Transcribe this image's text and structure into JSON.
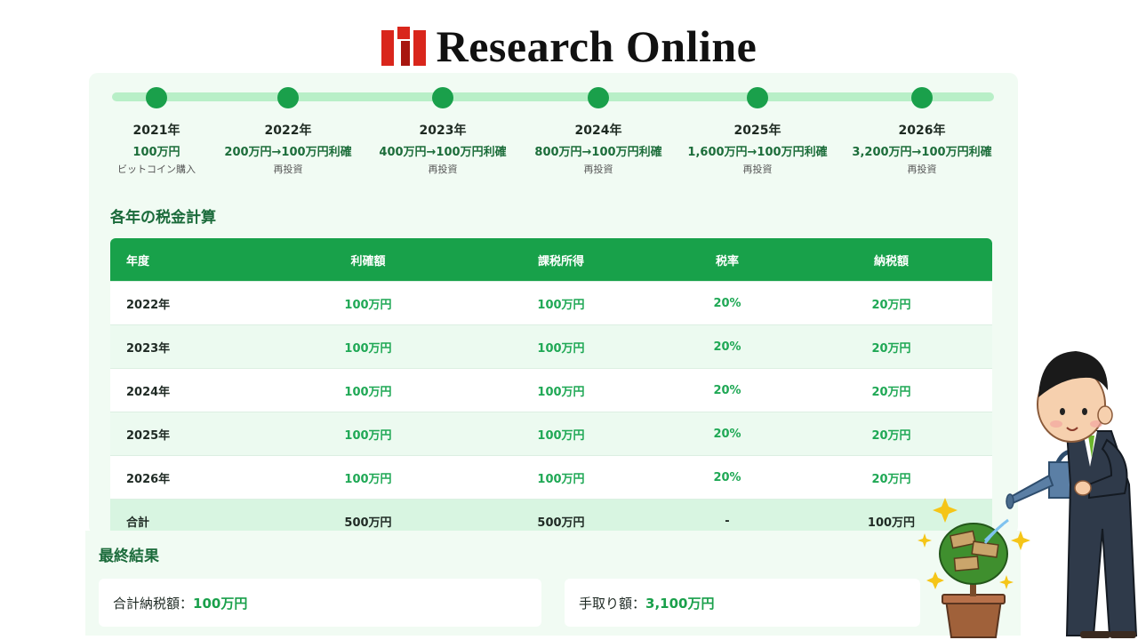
{
  "header": {
    "logo_text": "Research Online"
  },
  "timeline": [
    {
      "year": "2021年",
      "amount": "100万円",
      "note": "ビットコイン購入"
    },
    {
      "year": "2022年",
      "amount": "200万円→100万円利確",
      "note": "再投資"
    },
    {
      "year": "2023年",
      "amount": "400万円→100万円利確",
      "note": "再投資"
    },
    {
      "year": "2024年",
      "amount": "800万円→100万円利確",
      "note": "再投資"
    },
    {
      "year": "2025年",
      "amount": "1,600万円→100万円利確",
      "note": "再投資"
    },
    {
      "year": "2026年",
      "amount": "3,200万円→100万円利確",
      "note": "再投資"
    }
  ],
  "tax_section": {
    "title": "各年の税金計算",
    "headers": [
      "年度",
      "利確額",
      "課税所得",
      "税率",
      "納税額"
    ],
    "rows": [
      [
        "2022年",
        "100万円",
        "100万円",
        "20%",
        "20万円"
      ],
      [
        "2023年",
        "100万円",
        "100万円",
        "20%",
        "20万円"
      ],
      [
        "2024年",
        "100万円",
        "100万円",
        "20%",
        "20万円"
      ],
      [
        "2025年",
        "100万円",
        "100万円",
        "20%",
        "20万円"
      ],
      [
        "2026年",
        "100万円",
        "100万円",
        "20%",
        "20万円"
      ]
    ],
    "total": [
      "合計",
      "500万円",
      "500万円",
      "-",
      "100万円"
    ]
  },
  "final_result": {
    "title": "最終結果",
    "tax_label": "合計納税額：",
    "tax_value": "100万円",
    "net_label": "手取り額：",
    "net_value": "3,100万円"
  },
  "colors": {
    "accent": "#18a14a",
    "accent_light": "#b8efc7",
    "panel_bg": "#f1fbf3",
    "logo_red": "#d9261c"
  }
}
